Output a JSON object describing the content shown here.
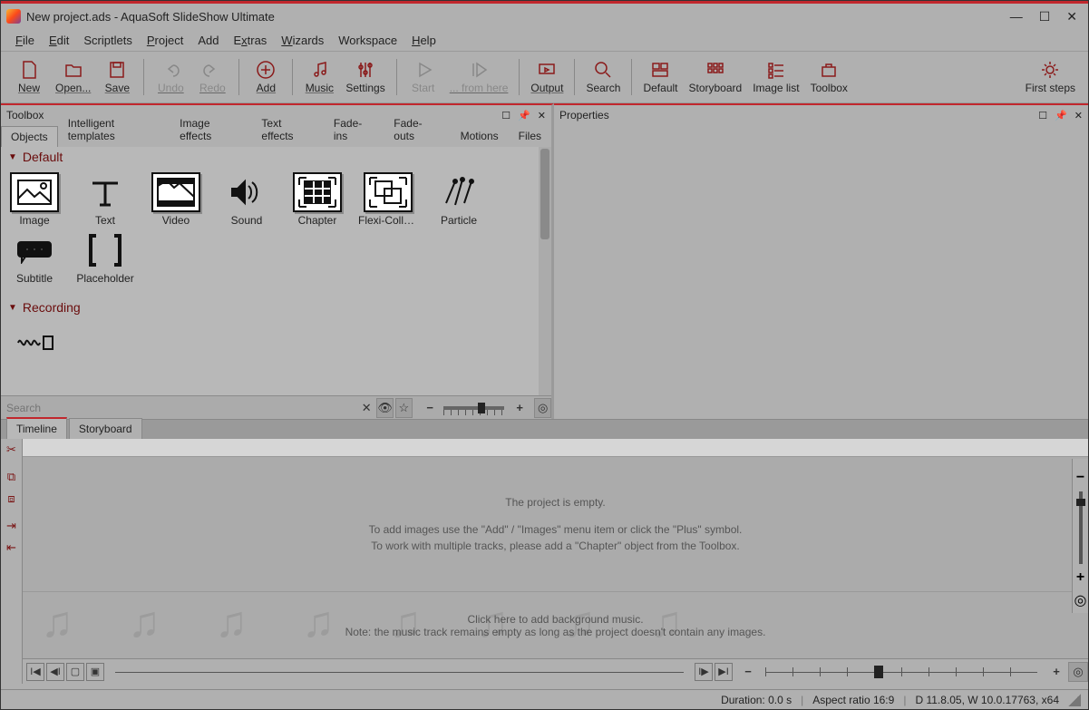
{
  "window": {
    "title": "New project.ads - AquaSoft SlideShow Ultimate",
    "min": "—",
    "max": "☐",
    "close": "✕"
  },
  "menu": [
    "File",
    "Edit",
    "Scriptlets",
    "Project",
    "Add",
    "Extras",
    "Wizards",
    "Workspace",
    "Help"
  ],
  "toolbar": [
    {
      "label": "New",
      "icon": "new"
    },
    {
      "label": "Open...",
      "icon": "open"
    },
    {
      "label": "Save",
      "icon": "save"
    },
    {
      "sep": true
    },
    {
      "label": "Undo",
      "icon": "undo",
      "disabled": true
    },
    {
      "label": "Redo",
      "icon": "redo",
      "disabled": true
    },
    {
      "sep": true
    },
    {
      "label": "Add",
      "icon": "add"
    },
    {
      "sep": true
    },
    {
      "label": "Music",
      "icon": "music"
    },
    {
      "label": "Settings",
      "icon": "settings"
    },
    {
      "sep": true
    },
    {
      "label": "Start",
      "icon": "play",
      "disabled": true
    },
    {
      "label": "... from here",
      "icon": "playhere",
      "disabled": true
    },
    {
      "sep": true
    },
    {
      "label": "Output",
      "icon": "output"
    },
    {
      "sep": true
    },
    {
      "label": "Search",
      "icon": "search"
    },
    {
      "sep": true
    },
    {
      "label": "Default",
      "icon": "default"
    },
    {
      "label": "Storyboard",
      "icon": "storyboard"
    },
    {
      "label": "Image list",
      "icon": "imagelist"
    },
    {
      "label": "Toolbox",
      "icon": "toolbox"
    }
  ],
  "firstSteps": "First steps",
  "panels": {
    "toolbox": {
      "title": "Toolbox"
    },
    "properties": {
      "title": "Properties"
    }
  },
  "toolboxTabs": [
    "Objects",
    "Intelligent templates",
    "Image effects",
    "Text effects",
    "Fade-ins",
    "Fade-outs",
    "Motions",
    "Files"
  ],
  "sections": {
    "default": {
      "title": "Default",
      "items": [
        "Image",
        "Text",
        "Video",
        "Sound",
        "Chapter",
        "Flexi-Colla...",
        "Particle",
        "Subtitle",
        "Placeholder"
      ]
    },
    "recording": {
      "title": "Recording"
    }
  },
  "search": {
    "placeholder": "Search"
  },
  "bottomTabs": [
    "Timeline",
    "Storyboard"
  ],
  "timeline": {
    "empty1": "The project is empty.",
    "empty2": "To add images use the \"Add\" / \"Images\" menu item or click the \"Plus\" symbol.",
    "empty3": "To work with multiple tracks, please add a \"Chapter\" object from the Toolbox.",
    "music1": "Click here to add background music.",
    "music2": "Note: the music track remains empty as long as the project doesn't contain any images."
  },
  "status": {
    "duration": "Duration: 0.0 s",
    "aspect": "Aspect ratio 16:9",
    "build": "D 11.8.05, W 10.0.17763, x64"
  }
}
